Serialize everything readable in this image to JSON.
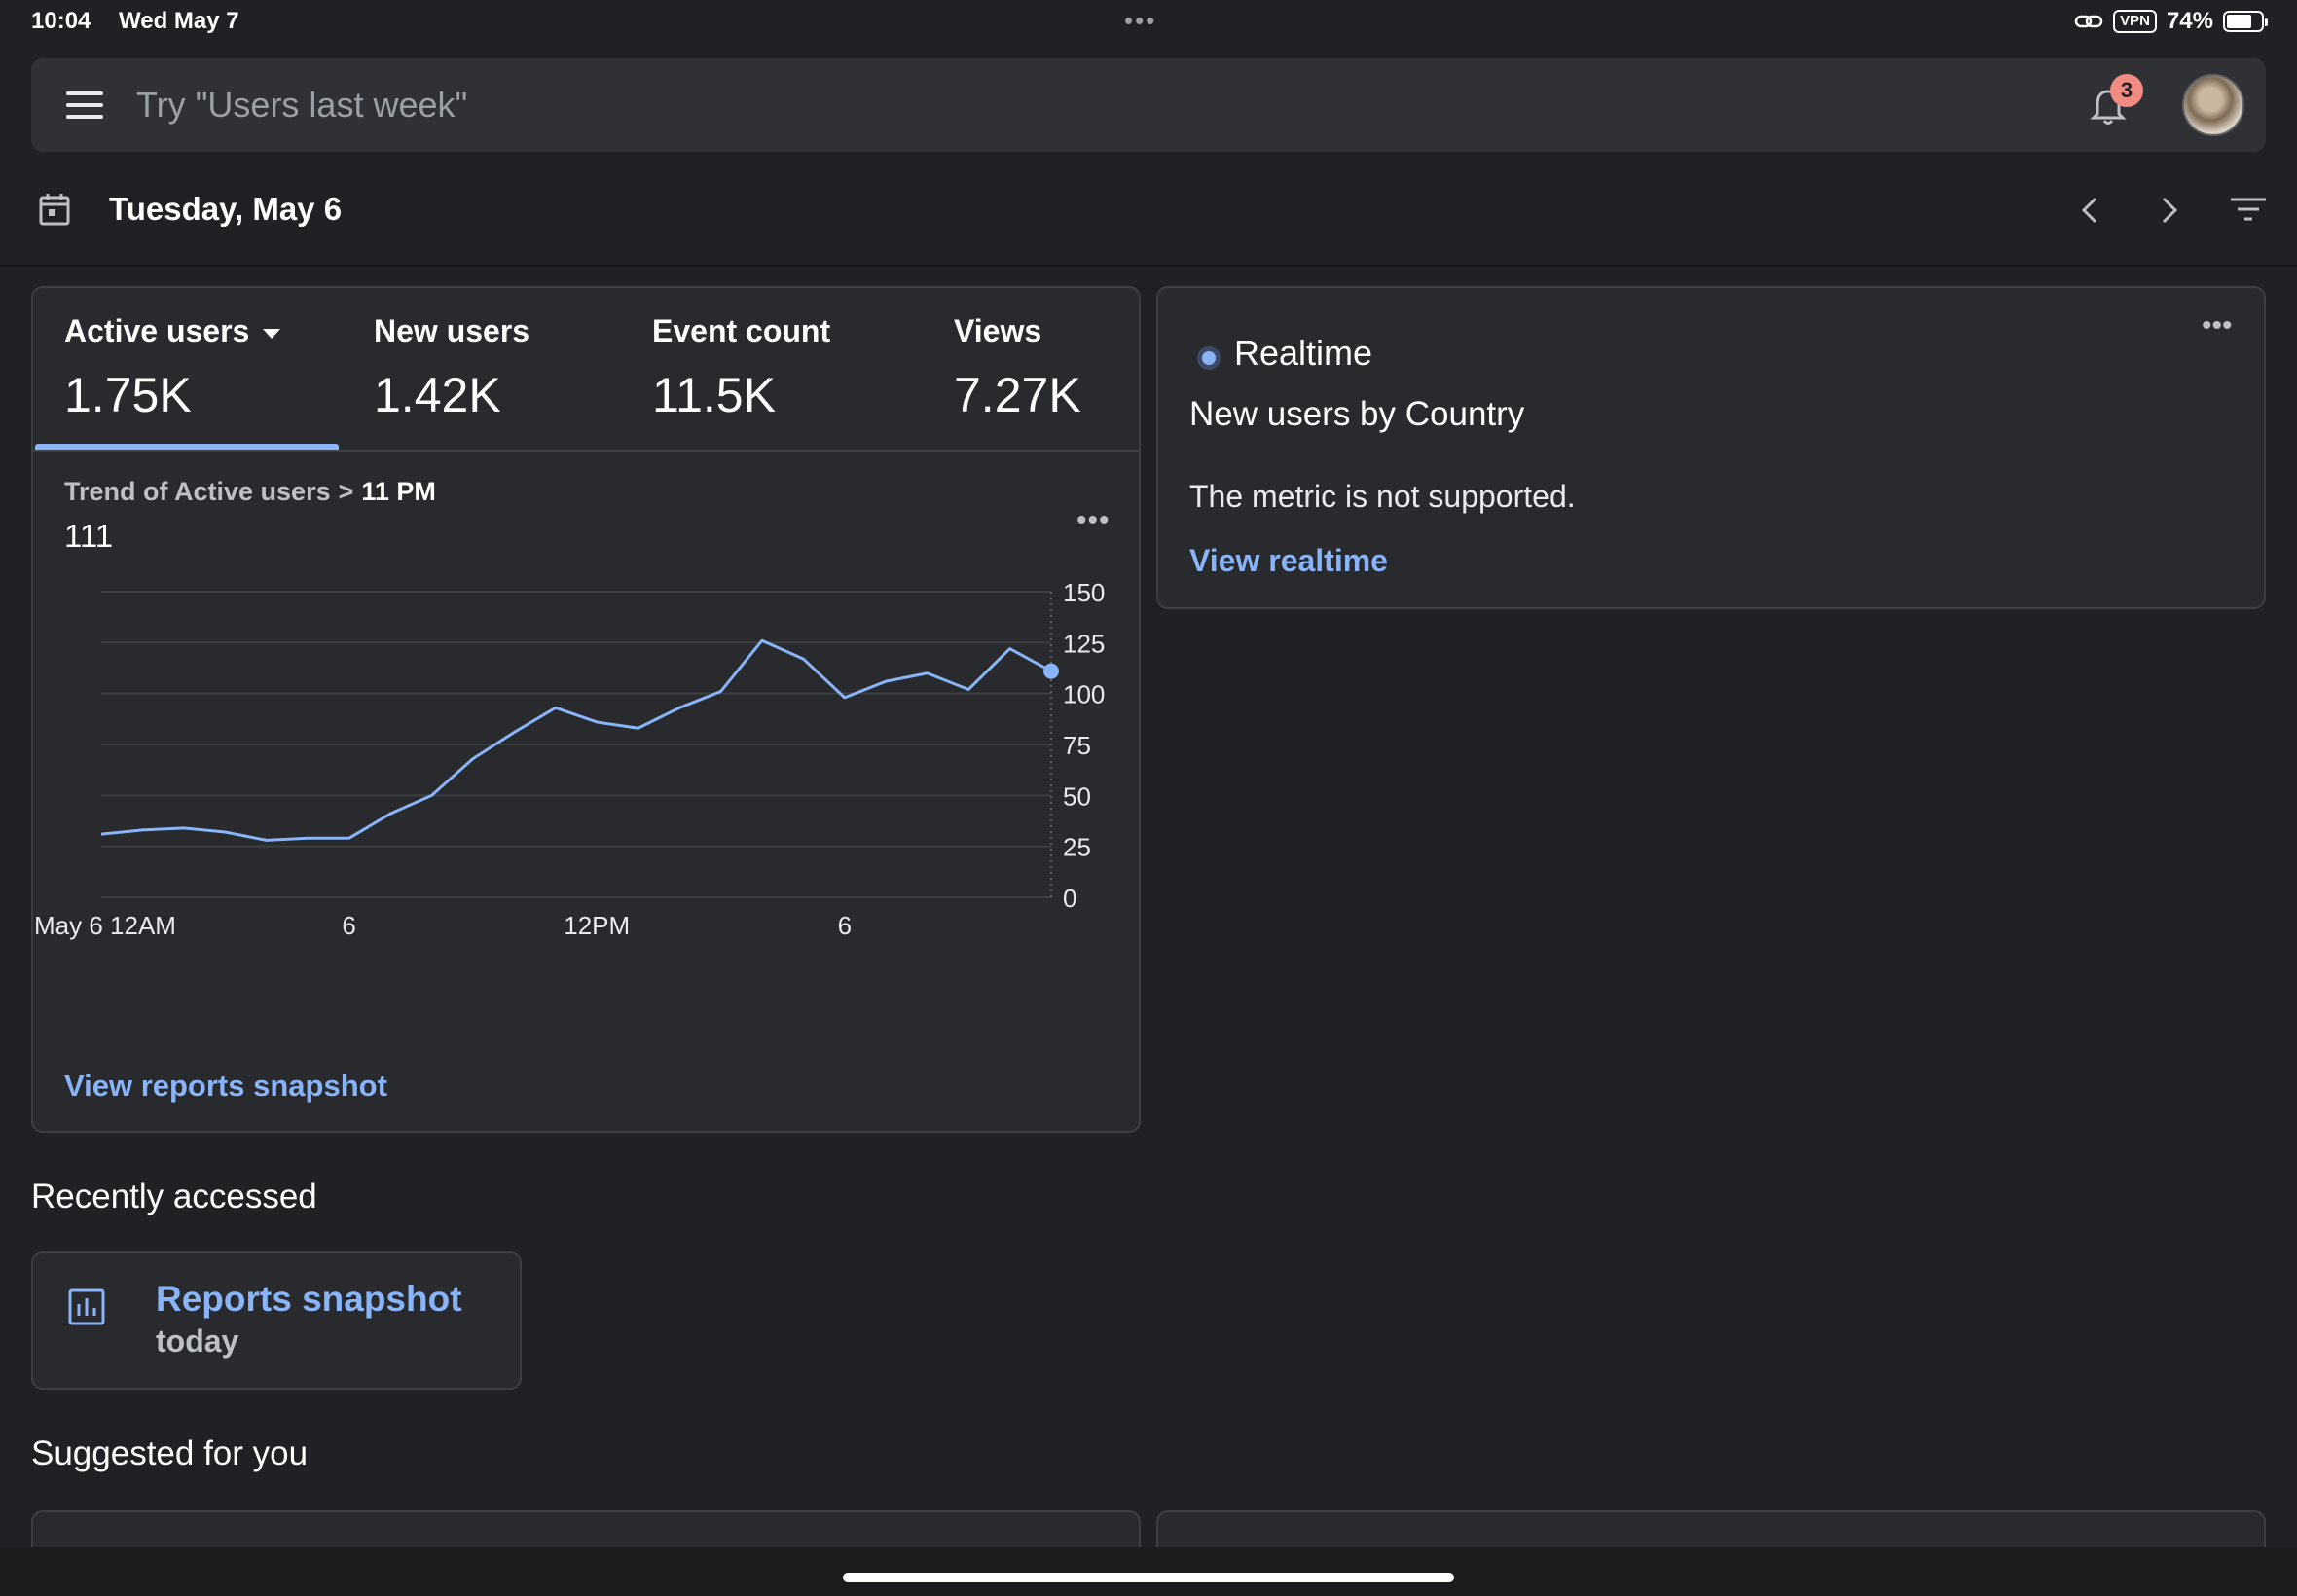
{
  "status_bar": {
    "time": "10:04",
    "date": "Wed May 7",
    "vpn": "VPN",
    "battery": "74%",
    "battery_level": 0.74
  },
  "search": {
    "placeholder": "Try \"Users last week\"",
    "notification_count": "3"
  },
  "date_row": {
    "date": "Tuesday, May 6"
  },
  "metrics": {
    "tabs": [
      {
        "label": "Active users",
        "value": "1.75K",
        "selected": true
      },
      {
        "label": "New users",
        "value": "1.42K"
      },
      {
        "label": "Event count",
        "value": "11.5K"
      },
      {
        "label": "Views",
        "value": "7.27K"
      }
    ],
    "trend_label": "Trend of Active users",
    "trend_time": "11 PM",
    "trend_value": "111",
    "view_link": "View reports snapshot"
  },
  "chart_data": {
    "type": "line",
    "x": [
      "May 6 12AM",
      "1",
      "2",
      "3",
      "4",
      "5",
      "6",
      "7",
      "8",
      "9",
      "10",
      "11",
      "12PM",
      "13",
      "14",
      "15",
      "16",
      "17",
      "18",
      "19",
      "20",
      "21",
      "22",
      "23"
    ],
    "xticks": [
      "May 6 12AM",
      "6",
      "12PM",
      "6"
    ],
    "series": [
      {
        "values": [
          31,
          33,
          34,
          32,
          28,
          29,
          29,
          41,
          50,
          68,
          81,
          93,
          86,
          83,
          93,
          101,
          126,
          117,
          98,
          106,
          110,
          102,
          122,
          111
        ]
      }
    ],
    "ylim": [
      0,
      150
    ],
    "yticks": [
      0,
      25,
      50,
      75,
      100,
      125,
      150
    ],
    "grid": true,
    "color": "#8ab4f8"
  },
  "realtime": {
    "title": "Realtime",
    "subtitle": "New users by Country",
    "message": "The metric is not supported.",
    "link": "View realtime"
  },
  "recent": {
    "heading": "Recently accessed",
    "item_title": "Reports snapshot",
    "item_sub": "today"
  },
  "suggested": {
    "heading": "Suggested for you"
  }
}
